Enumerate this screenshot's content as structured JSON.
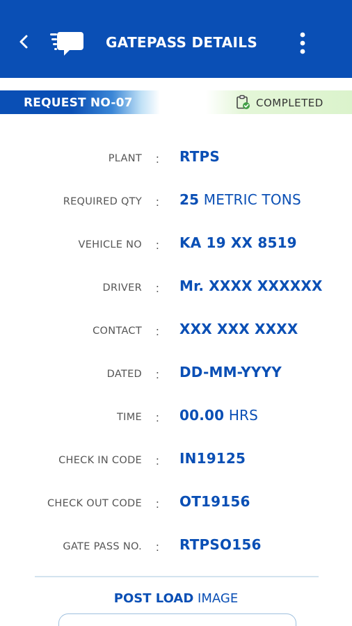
{
  "appbar": {
    "title": "GATEPASS DETAILS",
    "back_icon": "chevron-left-icon",
    "app_icon": "chat-list-icon",
    "menu_icon": "more-vertical-icon",
    "background_color": "#0a4fb5"
  },
  "status": {
    "request_label": "REQUEST NO-07",
    "completed_label": "COMPLETED",
    "completed_icon": "clipboard-check-icon"
  },
  "details": [
    {
      "label": "PLANT",
      "value_bold": "RTPS",
      "value_rest": ""
    },
    {
      "label": "REQUIRED QTY",
      "value_bold": "25",
      "value_rest": " METRIC TONS"
    },
    {
      "label": "VEHICLE NO",
      "value_bold": "KA 19 XX 8519",
      "value_rest": ""
    },
    {
      "label": "DRIVER",
      "value_bold": "Mr. XXXX XXXXXX",
      "value_rest": ""
    },
    {
      "label": "CONTACT",
      "value_bold": "XXX XXX XXXX",
      "value_rest": ""
    },
    {
      "label": "DATED",
      "value_bold": "DD-MM-YYYY",
      "value_rest": ""
    },
    {
      "label": "TIME",
      "value_bold": "00.00",
      "value_rest": " HRS"
    },
    {
      "label": "CHECK IN CODE",
      "value_bold": "IN19125",
      "value_rest": ""
    },
    {
      "label": "CHECK OUT CODE",
      "value_bold": "OT19156",
      "value_rest": ""
    },
    {
      "label": "GATE PASS NO.",
      "value_bold": "RTPSO156",
      "value_rest": ""
    }
  ],
  "colon": ":",
  "post_load": {
    "bold": "POST LOAD",
    "rest": " IMAGE"
  },
  "accent_color": "#0a4fb5",
  "completed_bg": "#dbf3cc"
}
